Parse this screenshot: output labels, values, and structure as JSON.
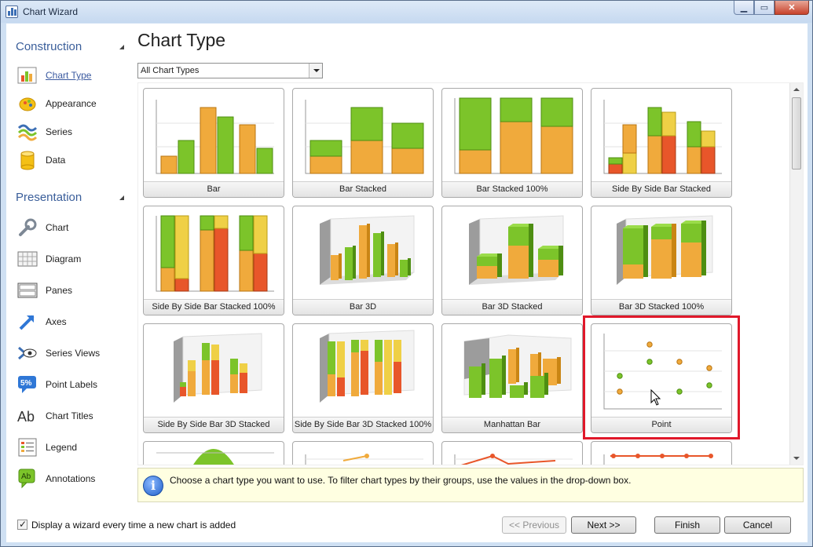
{
  "window": {
    "title": "Chart Wizard",
    "min_glyph": "▁",
    "max_glyph": "▭",
    "close_glyph": "✕"
  },
  "sidebar": {
    "construction_header": "Construction",
    "presentation_header": "Presentation",
    "construction_items": [
      {
        "label": "Chart Type",
        "icon": "chart-type-icon"
      },
      {
        "label": "Appearance",
        "icon": "appearance-icon"
      },
      {
        "label": "Series",
        "icon": "series-icon"
      },
      {
        "label": "Data",
        "icon": "data-icon"
      }
    ],
    "presentation_items": [
      {
        "label": "Chart",
        "icon": "wrench-icon"
      },
      {
        "label": "Diagram",
        "icon": "diagram-icon"
      },
      {
        "label": "Panes",
        "icon": "panes-icon"
      },
      {
        "label": "Axes",
        "icon": "axes-icon"
      },
      {
        "label": "Series Views",
        "icon": "series-views-icon"
      },
      {
        "label": "Point Labels",
        "icon": "point-labels-icon",
        "badge": "5%"
      },
      {
        "label": "Chart Titles",
        "icon": "chart-titles-icon",
        "badge": "Ab"
      },
      {
        "label": "Legend",
        "icon": "legend-icon"
      },
      {
        "label": "Annotations",
        "icon": "annotations-icon",
        "badge": "Ab"
      }
    ],
    "active": "Chart Type"
  },
  "main": {
    "title": "Chart Type",
    "filter_value": "All Chart Types",
    "tiles": [
      "Bar",
      "Bar Stacked",
      "Bar Stacked 100%",
      "Side By Side Bar Stacked",
      "Side By Side Bar Stacked 100%",
      "Bar 3D",
      "Bar 3D Stacked",
      "Bar 3D Stacked 100%",
      "Side By Side Bar 3D Stacked",
      "Side By Side Bar 3D Stacked 100%",
      "Manhattan Bar",
      "Point"
    ],
    "selected_tile": "Point",
    "hint": "Choose a chart type you want to use. To filter chart types by their groups, use the values in the drop-down box."
  },
  "footer": {
    "checkbox_label": "Display a wizard every time a new chart is added",
    "checkbox_checked": true,
    "previous": "<< Previous",
    "next": "Next >>",
    "finish": "Finish",
    "cancel": "Cancel"
  },
  "colors": {
    "green": "#7cc42a",
    "orange": "#f0aa3c",
    "red": "#e8562a",
    "yellow": "#efd046",
    "selection": "#e0182a"
  }
}
